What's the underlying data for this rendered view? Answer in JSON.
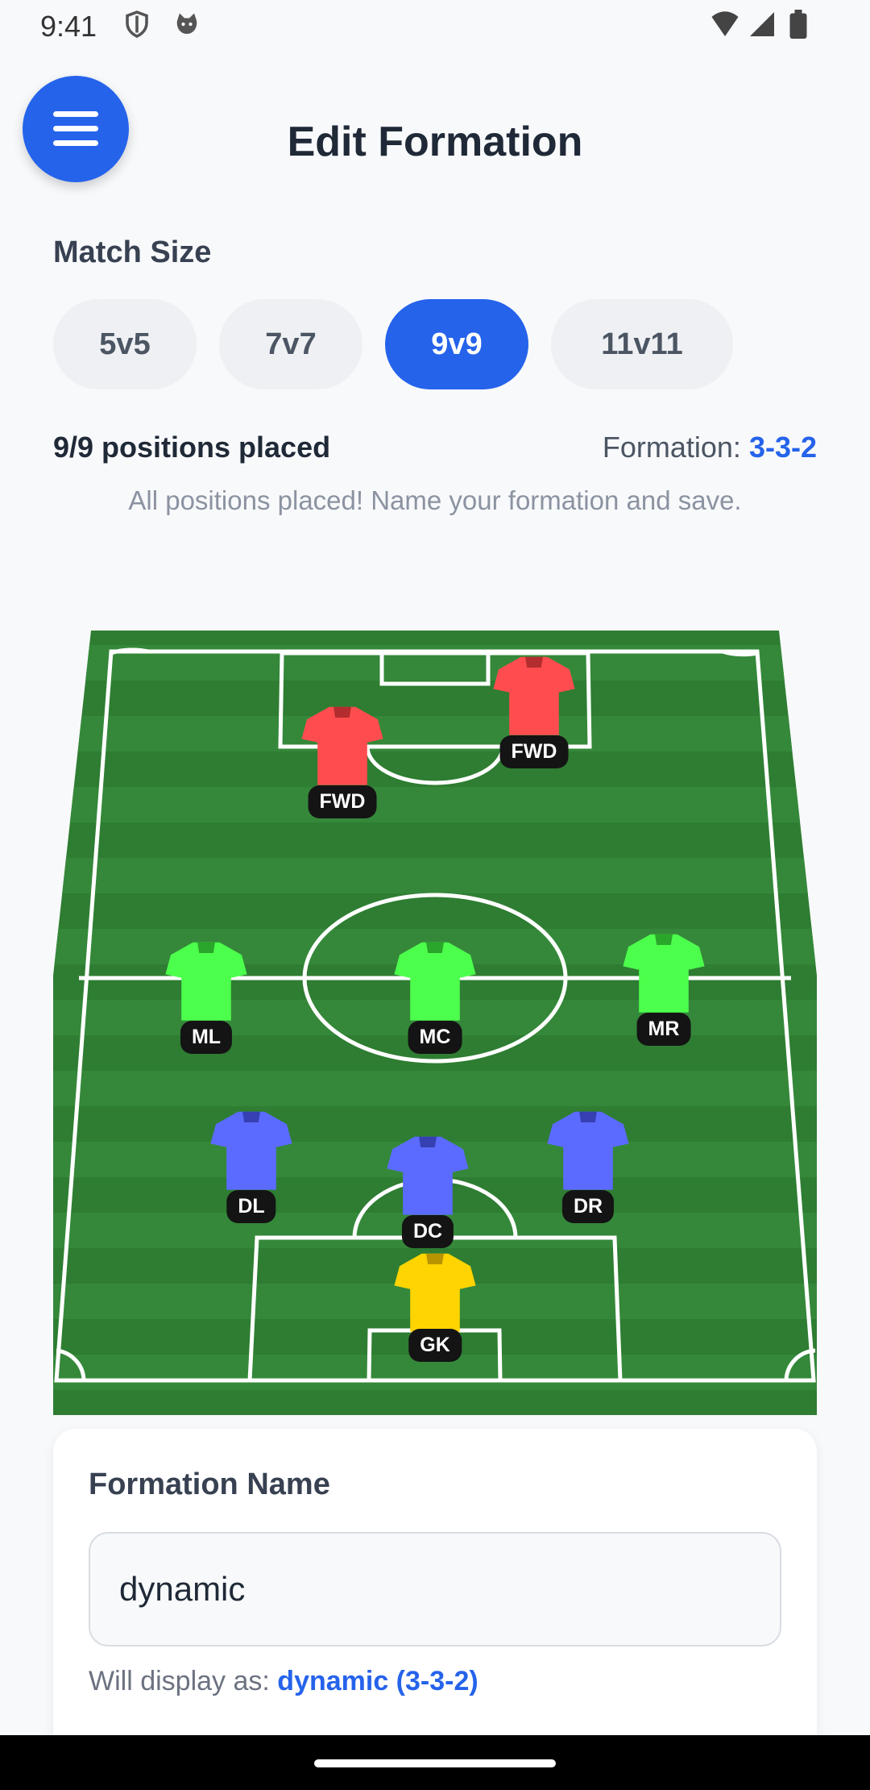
{
  "status_bar": {
    "time": "9:41",
    "left_icons": [
      "shield-icon",
      "cat-face-icon"
    ],
    "right_icons": [
      "wifi-icon",
      "cellular-signal-icon",
      "battery-icon"
    ]
  },
  "header": {
    "menu_icon": "hamburger-menu-icon",
    "title": "Edit Formation"
  },
  "match_size": {
    "label": "Match Size",
    "options": [
      "5v5",
      "7v7",
      "9v9",
      "11v11"
    ],
    "selected": "9v9"
  },
  "progress": {
    "placed_text": "9/9 positions placed",
    "formation_label": "Formation:",
    "formation_value": "3-3-2",
    "hint": "All positions placed! Name your formation and save."
  },
  "pitch": {
    "players": [
      {
        "label": "FWD",
        "role": "forward",
        "color": "#ff4d4f"
      },
      {
        "label": "FWD",
        "role": "forward",
        "color": "#ff4d4f"
      },
      {
        "label": "ML",
        "role": "midfielder",
        "color": "#4cff4c"
      },
      {
        "label": "MC",
        "role": "midfielder",
        "color": "#4cff4c"
      },
      {
        "label": "MR",
        "role": "midfielder",
        "color": "#4cff4c"
      },
      {
        "label": "DL",
        "role": "defender",
        "color": "#5b6bff"
      },
      {
        "label": "DC",
        "role": "defender",
        "color": "#5b6bff"
      },
      {
        "label": "DR",
        "role": "defender",
        "color": "#5b6bff"
      },
      {
        "label": "GK",
        "role": "goalkeeper",
        "color": "#ffd400"
      }
    ]
  },
  "name_card": {
    "title": "Formation Name",
    "input_value": "dynamic",
    "display_prefix": "Will display as:",
    "display_value": "dynamic (3-3-2)"
  },
  "colors": {
    "accent": "#2563eb",
    "pitch_dark": "#2e7d32",
    "pitch_light": "#388e3c"
  }
}
